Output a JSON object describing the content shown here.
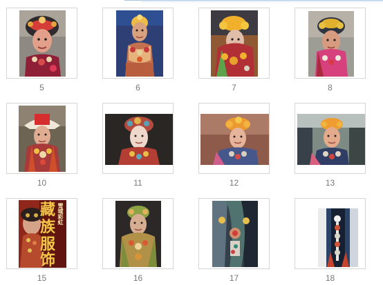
{
  "gallery": {
    "items": [
      {
        "number": "5"
      },
      {
        "number": "6"
      },
      {
        "number": "7"
      },
      {
        "number": "8"
      },
      {
        "number": "10"
      },
      {
        "number": "11"
      },
      {
        "number": "12"
      },
      {
        "number": "13"
      },
      {
        "number": "15",
        "poster_title": "藏族服饰",
        "poster_side": "雪域彩虹",
        "poster_title_top": "藏",
        "poster_title_2": "族",
        "poster_title_3": "服",
        "poster_title_4": "饰"
      },
      {
        "number": "16"
      },
      {
        "number": "17"
      },
      {
        "number": "18"
      }
    ]
  },
  "colors": {
    "caption": "#777777",
    "frame_border": "#d5d5d5",
    "top_rule": "#a9c6e4"
  }
}
